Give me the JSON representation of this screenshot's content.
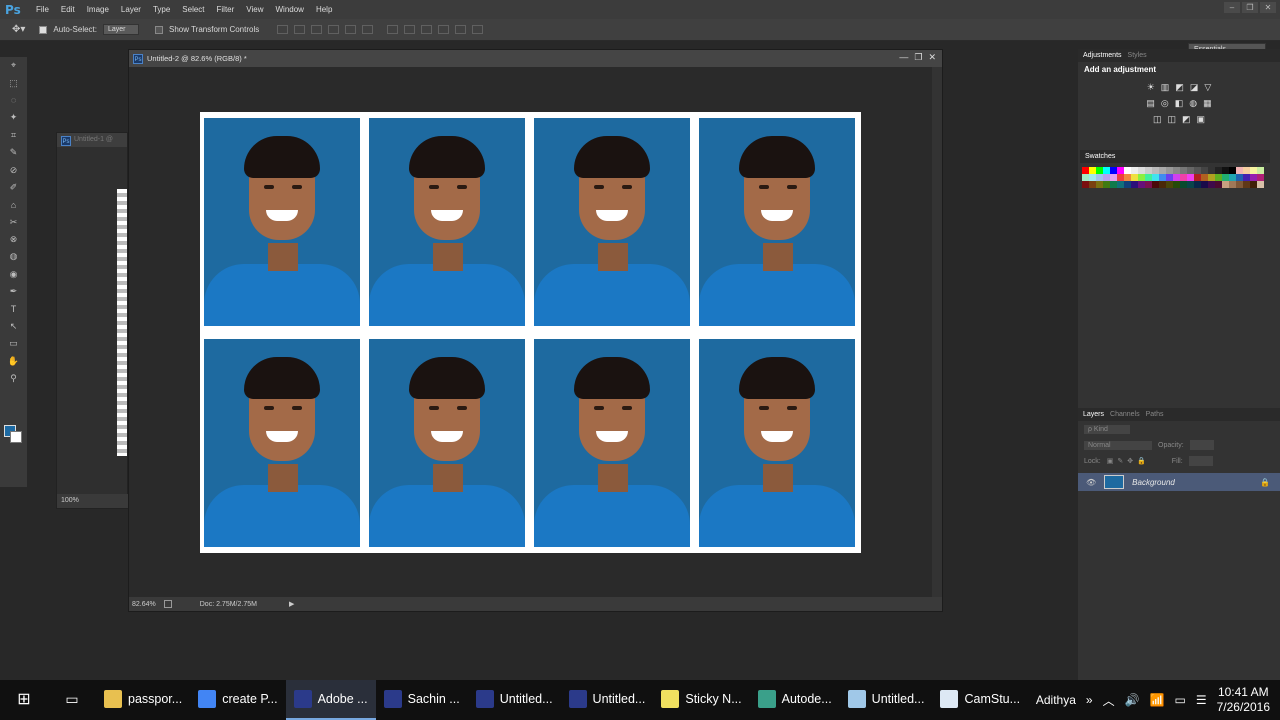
{
  "app": {
    "logo": "Ps"
  },
  "menu": [
    "File",
    "Edit",
    "Image",
    "Layer",
    "Type",
    "Select",
    "Filter",
    "View",
    "Window",
    "Help"
  ],
  "window_controls": [
    "–",
    "❐",
    "✕"
  ],
  "options": {
    "auto_select_label": "Auto-Select:",
    "auto_select_value": "Layer",
    "transform_label": "Show Transform Controls",
    "workspace": "Essentials"
  },
  "tools": [
    "⌖",
    "⬚",
    "◌",
    "✦",
    "⌗",
    "✎",
    "⊘",
    "✐",
    "⌂",
    "✂",
    "⊗",
    "◍",
    "◉",
    "✒",
    "T",
    "↖",
    "▭",
    "✋",
    "⚲"
  ],
  "doc1": {
    "title": "Untitled-1 @",
    "zoom": "100%"
  },
  "doc2": {
    "title": "Untitled-2 @ 82.6% (RGB/8) *",
    "zoom": "82.64%",
    "doc_size": "Doc: 2.75M/2.75M",
    "btns": [
      "—",
      "❐",
      "✕"
    ]
  },
  "panels": {
    "adj_tabs": [
      "Adjustments",
      "Styles"
    ],
    "adj_title": "Add an adjustment",
    "adj_rows": [
      [
        "☀",
        "▥",
        "◩",
        "◪",
        "▽"
      ],
      [
        "▤",
        "◎",
        "◧",
        "◍",
        "▦"
      ],
      [
        "◫",
        "◫",
        "◩",
        "▣"
      ]
    ],
    "swatches_tab": "Swatches",
    "layers_tabs": [
      "Layers",
      "Channels",
      "Paths"
    ],
    "kind": "ρ Kind",
    "blend": "Normal",
    "opacity_label": "Opacity:",
    "lock_label": "Lock:",
    "fill_label": "Fill:",
    "layer_name": "Background"
  },
  "swatch_colors": [
    "#ff0000",
    "#ffff00",
    "#00ff00",
    "#00ffff",
    "#0000ff",
    "#ff00ff",
    "#ffffff",
    "#eeeeee",
    "#dddddd",
    "#cccccc",
    "#bbbbbb",
    "#aaaaaa",
    "#999999",
    "#888888",
    "#777777",
    "#666666",
    "#555555",
    "#444444",
    "#333333",
    "#222222",
    "#111111",
    "#000000",
    "#f2b4b4",
    "#f5cfa0",
    "#f7f3a0",
    "#c9efa0",
    "#a0efc6",
    "#a0e9ef",
    "#a0c4ef",
    "#b8a0ef",
    "#e6a0ef",
    "#ef4040",
    "#ef8a40",
    "#efe040",
    "#8bef40",
    "#40ef9c",
    "#40e4ef",
    "#408cef",
    "#6a40ef",
    "#d140ef",
    "#ef40a8",
    "#ef40ef",
    "#b02020",
    "#b06020",
    "#b0a220",
    "#5fb020",
    "#20b070",
    "#20a4b0",
    "#2060b0",
    "#4420b0",
    "#9420b0",
    "#b02078",
    "#7a1010",
    "#7a4010",
    "#7a7010",
    "#407a10",
    "#107a4c",
    "#10707a",
    "#10407a",
    "#2c107a",
    "#66107a",
    "#7a1050",
    "#4a0a0a",
    "#4a280a",
    "#4a460a",
    "#264a0a",
    "#0a4a2e",
    "#0a444a",
    "#0a264a",
    "#1a0a4a",
    "#3e0a4a",
    "#4a0a30",
    "#c8a080",
    "#a07858",
    "#805838",
    "#603818",
    "#402008",
    "#d8c0a8"
  ],
  "taskbar": [
    {
      "label": "passpor...",
      "color": "#e8c050"
    },
    {
      "label": "create P...",
      "color": "#4285f4"
    },
    {
      "label": "Adobe ...",
      "color": "#2b3a8a",
      "active": true
    },
    {
      "label": "Sachin ...",
      "color": "#2b3a8a"
    },
    {
      "label": "Untitled...",
      "color": "#2b3a8a"
    },
    {
      "label": "Untitled...",
      "color": "#2b3a8a"
    },
    {
      "label": "Sticky N...",
      "color": "#f0e060"
    },
    {
      "label": "Autode...",
      "color": "#3aa08a"
    },
    {
      "label": "Untitled...",
      "color": "#a0c8e8"
    },
    {
      "label": "CamStu...",
      "color": "#dde8f4"
    }
  ],
  "tray": {
    "user": "Adithya",
    "time": "10:41 AM",
    "date": "7/26/2016"
  }
}
